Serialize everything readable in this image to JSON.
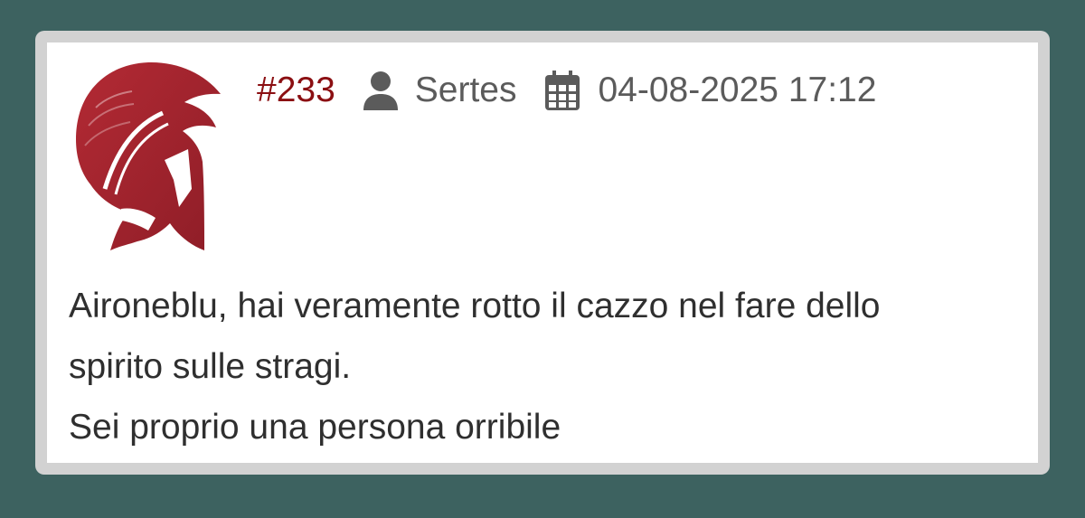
{
  "post": {
    "number": "#233",
    "author": "Sertes",
    "datetime": "04-08-2025 17:12",
    "avatar_icon": "spartan-helmet-icon",
    "author_icon": "user-icon",
    "date_icon": "calendar-icon",
    "message_lines": [
      "Aironeblu, hai veramente rotto il cazzo nel fare dello",
      "spirito sulle stragi.",
      "Sei proprio una persona orribile"
    ]
  },
  "colors": {
    "background": "#3d6260",
    "card": "#ffffff",
    "frame": "#d2d2d2",
    "post_number": "#8b0f12",
    "meta_text": "#5b5b5b",
    "body_text": "#2f2f2f",
    "avatar": "#a8262f"
  }
}
